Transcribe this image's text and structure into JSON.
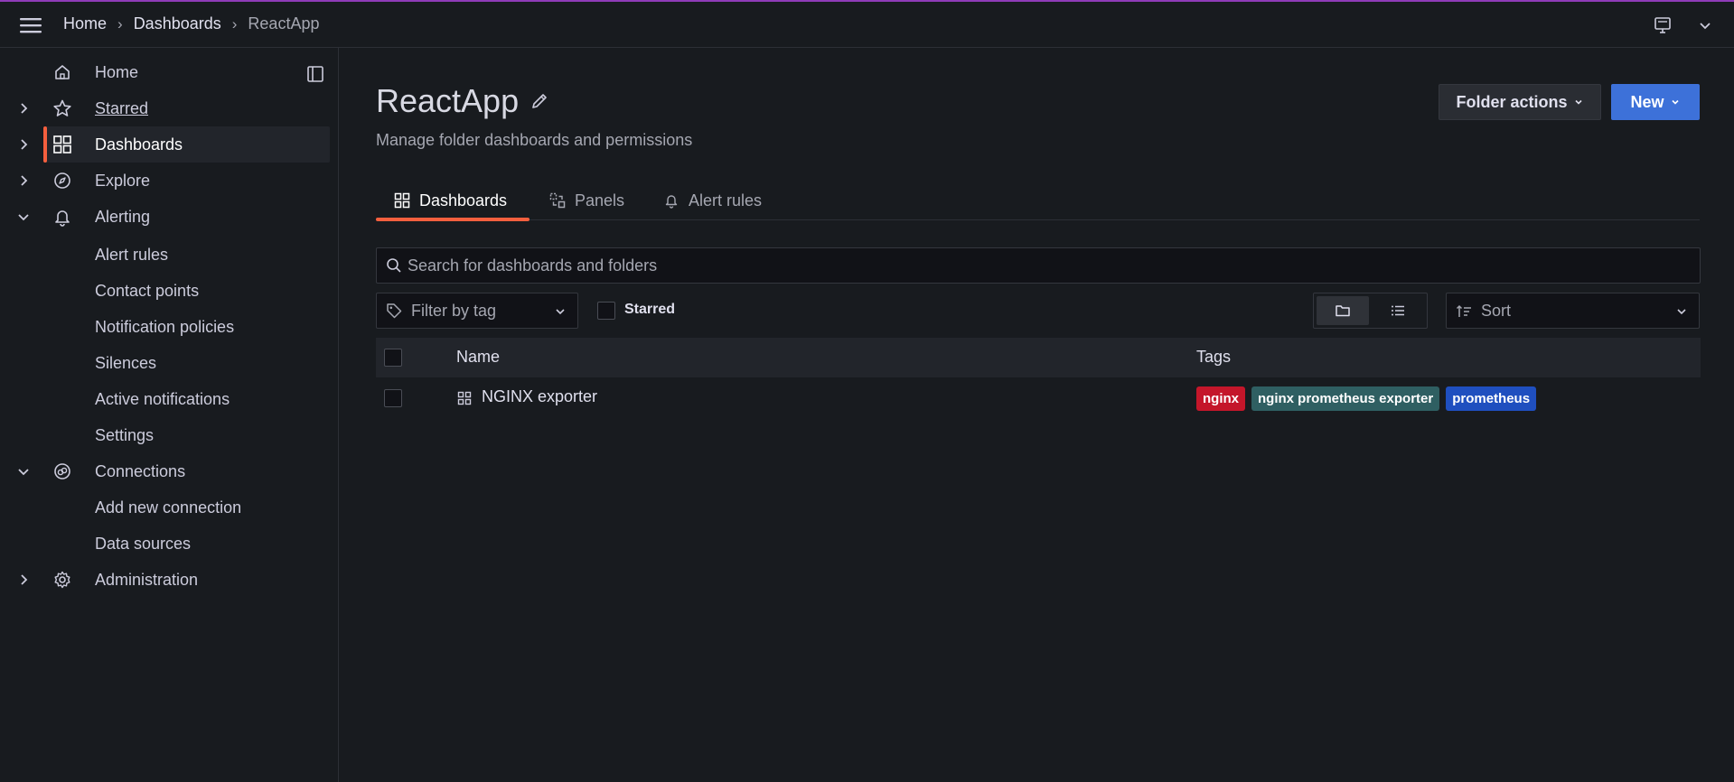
{
  "topbar": {
    "breadcrumbs": [
      "Home",
      "Dashboards",
      "ReactApp"
    ]
  },
  "sidebar": {
    "items": [
      {
        "label": "Home",
        "icon": "home-icon"
      },
      {
        "label": "Starred",
        "icon": "star-icon"
      },
      {
        "label": "Dashboards",
        "icon": "apps-icon"
      },
      {
        "label": "Explore",
        "icon": "compass-icon"
      },
      {
        "label": "Alerting",
        "icon": "bell-icon"
      },
      {
        "label": "Connections",
        "icon": "link-icon"
      },
      {
        "label": "Administration",
        "icon": "cog-icon"
      }
    ],
    "alerting_sub": [
      "Alert rules",
      "Contact points",
      "Notification policies",
      "Silences",
      "Active notifications",
      "Settings"
    ],
    "connections_sub": [
      "Add new connection",
      "Data sources"
    ]
  },
  "page": {
    "title": "ReactApp",
    "subtitle": "Manage folder dashboards and permissions",
    "folder_actions_label": "Folder actions",
    "new_label": "New"
  },
  "tabs": [
    {
      "label": "Dashboards",
      "active": true
    },
    {
      "label": "Panels",
      "active": false
    },
    {
      "label": "Alert rules",
      "active": false
    }
  ],
  "filters": {
    "search_placeholder": "Search for dashboards and folders",
    "tag_placeholder": "Filter by tag",
    "starred_label": "Starred",
    "sort_label": "Sort"
  },
  "table": {
    "columns": [
      "Name",
      "Tags"
    ],
    "rows": [
      {
        "name": "NGINX exporter",
        "tags": [
          {
            "label": "nginx",
            "color": "#c4162a"
          },
          {
            "label": "nginx prometheus exporter",
            "color": "#2f5f62"
          },
          {
            "label": "prometheus",
            "color": "#1f4fbf"
          }
        ]
      }
    ]
  },
  "colors": {
    "accent": "#f55f3e",
    "primary_button": "#3d71d9",
    "topbar_border": "#8f3bb8"
  }
}
